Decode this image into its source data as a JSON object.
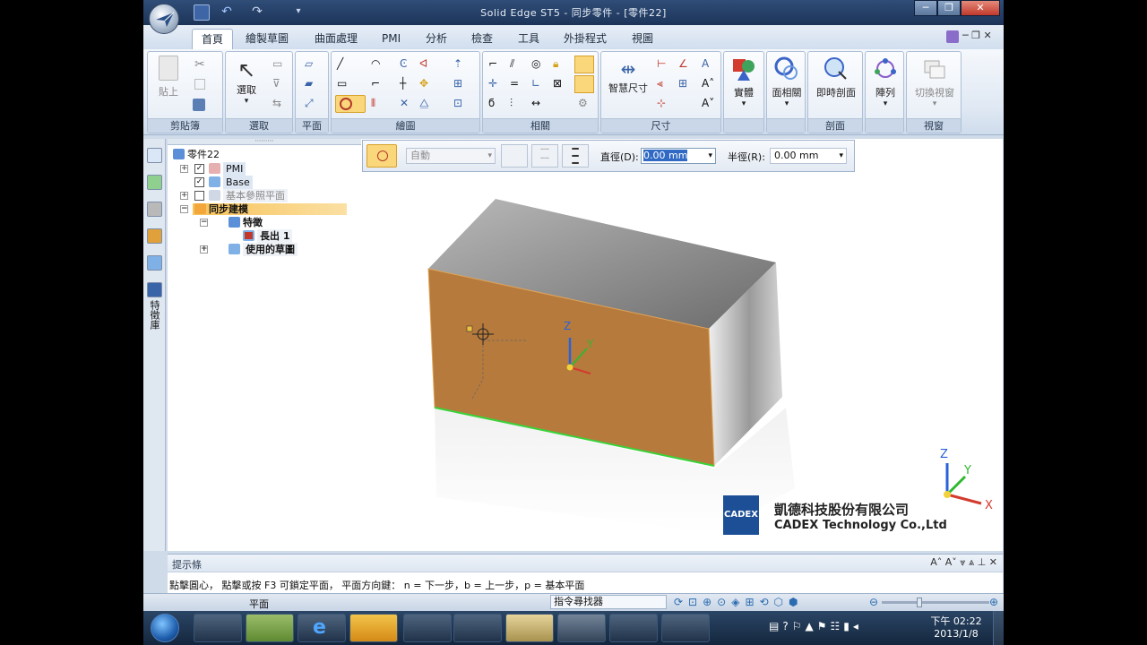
{
  "window": {
    "title": "Solid Edge ST5 - 同步零件 - [零件22]",
    "minimize": "─",
    "maximize": "❐",
    "close": "✕"
  },
  "tabs": [
    "首頁",
    "繪製草圖",
    "曲面處理",
    "PMI",
    "分析",
    "檢查",
    "工具",
    "外掛程式",
    "視圖"
  ],
  "ribbon": {
    "groups": {
      "clipboard": "剪貼簿",
      "select": "選取",
      "plane": "平面",
      "draw": "繪圖",
      "relate": "相關",
      "dimension": "尺寸",
      "solid": "",
      "face_relate": "",
      "section": "剖面",
      "pattern": "",
      "window": "視窗"
    },
    "buttons": {
      "paste": "貼上",
      "select": "選取",
      "smart_dim": "智慧尺寸",
      "solid": "實體",
      "face_relate": "面相關",
      "live_section": "即時剖面",
      "pattern": "陣列",
      "switch_window": "切換視窗"
    }
  },
  "tree": {
    "root": "零件22",
    "items": [
      {
        "label": "PMI"
      },
      {
        "label": "Base"
      },
      {
        "label": "基本參照平面"
      },
      {
        "label": "同步建模"
      },
      {
        "label": "特徵"
      },
      {
        "label": "長出 1"
      },
      {
        "label": "使用的草圖"
      }
    ]
  },
  "sidebar_vertical_label": "特徵庫",
  "command_bar": {
    "mode_value": "自動",
    "diameter_label": "直徑(D):",
    "diameter_value": "0.00 mm",
    "radius_label": "半徑(R):",
    "radius_value": "0.00 mm"
  },
  "triad": {
    "z": "Z",
    "y": "Y",
    "x": "X"
  },
  "watermark": {
    "logo": "CADEX",
    "company_zh": "凱德科技股份有限公司",
    "company_en": "CADEX Technology Co.,Ltd"
  },
  "prompt": {
    "header": "提示條",
    "text": "點擊圓心，  點擊或按 F3 可鎖定平面，  平面方向鍵： n = 下一步，b = 上一步，p = 基本平面"
  },
  "status": {
    "plane": "平面",
    "command_finder": "指令尋找器"
  },
  "taskbar": {
    "time": "下午 02:22",
    "date": "2013/1/8"
  },
  "colors": {
    "face_orange": "#b67a3c",
    "edge_green": "#3ad23a",
    "title_bg": "#1d3458",
    "taskbar_bg": "#14263d"
  }
}
